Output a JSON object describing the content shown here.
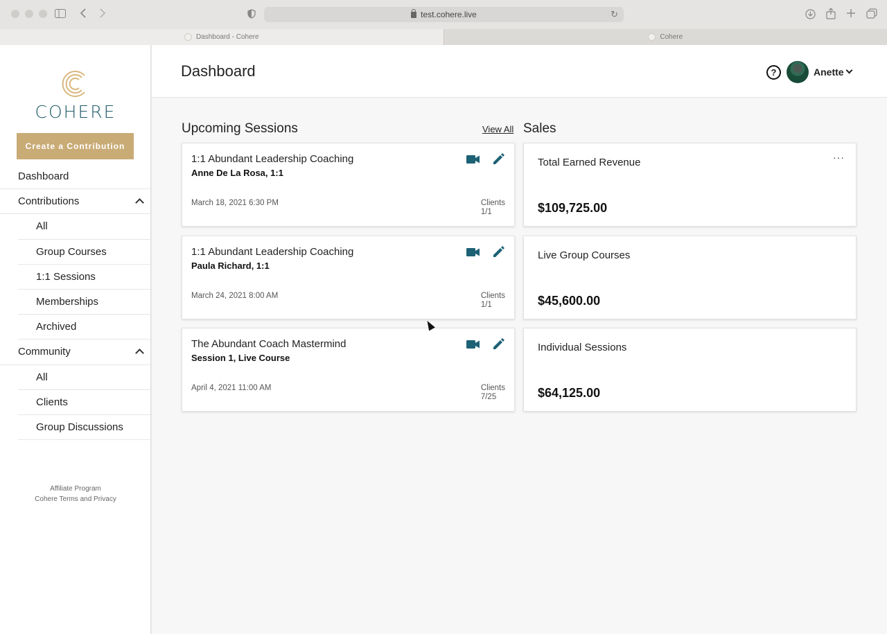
{
  "browser": {
    "url": "test.cohere.live",
    "tabs": [
      "Dashboard - Cohere",
      "Cohere"
    ]
  },
  "sidebar": {
    "logo_text": "COHERE",
    "create_button": "Create a Contribution",
    "items": [
      {
        "label": "Dashboard"
      },
      {
        "label": "Contributions"
      },
      {
        "label": "All"
      },
      {
        "label": "Group Courses"
      },
      {
        "label": "1:1 Sessions"
      },
      {
        "label": "Memberships"
      },
      {
        "label": "Archived"
      },
      {
        "label": "Community"
      },
      {
        "label": "All"
      },
      {
        "label": "Clients"
      },
      {
        "label": "Group Discussions"
      }
    ],
    "footer": {
      "affiliate": "Affiliate Program",
      "terms": "Cohere Terms and Privacy"
    }
  },
  "header": {
    "title": "Dashboard",
    "help_symbol": "?",
    "user_name": "Anette"
  },
  "sessions": {
    "title": "Upcoming Sessions",
    "view_all": "View All",
    "items": [
      {
        "title": "1:1 Abundant Leadership Coaching",
        "subtitle": "Anne De La Rosa, 1:1",
        "date": "March 18, 2021 6:30 PM",
        "clients_label": "Clients",
        "clients_value": "1/1"
      },
      {
        "title": "1:1 Abundant Leadership Coaching",
        "subtitle": "Paula Richard, 1:1",
        "date": "March 24, 2021 8:00 AM",
        "clients_label": "Clients",
        "clients_value": "1/1"
      },
      {
        "title": "The Abundant Coach Mastermind",
        "subtitle": "Session 1, Live Course",
        "date": "April 4, 2021 11:00 AM",
        "clients_label": "Clients",
        "clients_value": "7/25"
      }
    ]
  },
  "sales": {
    "title": "Sales",
    "more_symbol": "···",
    "items": [
      {
        "title": "Total Earned Revenue",
        "value": "$109,725.00"
      },
      {
        "title": "Live Group Courses",
        "value": "$45,600.00"
      },
      {
        "title": "Individual Sessions",
        "value": "$64,125.00"
      }
    ]
  },
  "colors": {
    "accent_gold": "#c9ab76",
    "brand_teal": "#1f5a66",
    "icon_teal": "#1d6175"
  }
}
